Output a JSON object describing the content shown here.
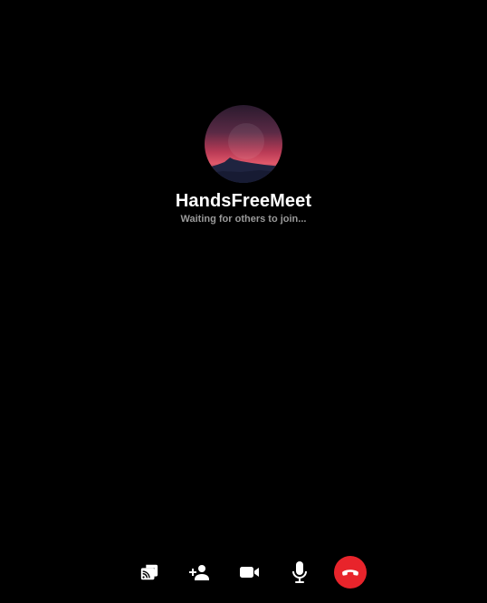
{
  "meeting": {
    "title": "HandsFreeMeet",
    "status": "Waiting for others to join..."
  },
  "controls": [
    {
      "name": "cast-screen-button",
      "icon": "cast-screen-icon"
    },
    {
      "name": "add-participant-button",
      "icon": "add-person-icon"
    },
    {
      "name": "video-button",
      "icon": "video-camera-icon"
    },
    {
      "name": "microphone-button",
      "icon": "microphone-icon"
    },
    {
      "name": "end-call-button",
      "icon": "end-call-icon"
    }
  ],
  "colors": {
    "background": "#000000",
    "title": "#ffffff",
    "status": "#9a9a9a",
    "end_call": "#e8242b",
    "icon": "#ffffff"
  }
}
